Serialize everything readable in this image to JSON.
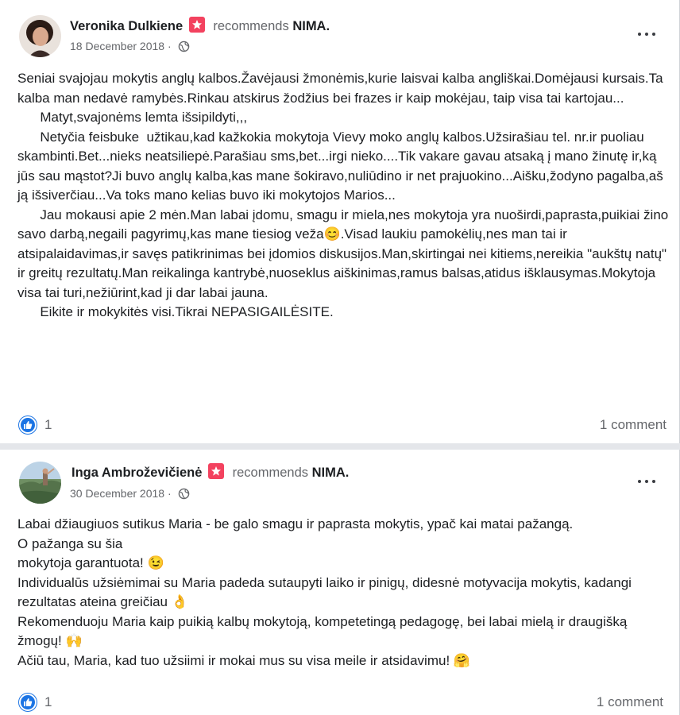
{
  "posts": [
    {
      "author": "Veronika Dulkiene",
      "action": "recommends",
      "page": "NIMA.",
      "date": "18 December 2018 ·",
      "body": [
        "Seniai svajojau mokytis anglų kalbos.Žavėjausi žmonėmis,kurie laisvai kalba angliškai.Domėjausi kursais.Ta kalba man nedavė ramybės.Rinkau atskirus žodžius bei frazes ir kaip mokėjau, taip visa tai kartojau...",
        "      Matyt,svajonėms lemta išsipildyti,,,",
        "      Netyčia feisbuke  užtikau,kad kažkokia mokytoja Vievy moko anglų kalbos.Užsirašiau tel. nr.ir puoliau skambinti.Bet...nieks neatsiliepė.Parašiau sms,bet...irgi nieko....Tik vakare gavau atsaką į mano žinutę ir,ką jūs sau mąstot?Ji buvo anglų kalba,kas mane šokiravo,nuliūdino ir net prajuokino...Aišku,žodyno pagalba,aš ją išsiverčiau...Va toks mano kelias buvo iki mokytojos Marios...",
        "      Jau mokausi apie 2 mėn.Man labai įdomu, smagu ir miela,nes mokytoja yra nuoširdi,paprasta,puikiai žino savo darbą,negaili pagyrimų,kas mane tiesiog veža😊.Visad laukiu pamokėlių,nes man tai ir atsipalaidavimas,ir savęs patikrinimas bei įdomios diskusijos.Man,skirtingai nei kitiems,nereikia \"aukštų natų\" ir greitų rezultatų.Man reikalinga kantrybė,nuoseklus aiškinimas,ramus balsas,atidus išklausymas.Mokytoja visa tai turi,nežiūrint,kad ji dar labai jauna.",
        "      Eikite ir mokykitės visi.Tikrai NEPASIGAILĖSITE."
      ],
      "likes": "1",
      "comments": "1 comment"
    },
    {
      "author": "Inga Ambroževičienė",
      "action": "recommends",
      "page": "NIMA.",
      "date": "30 December 2018 ·",
      "body": [
        "Labai džiaugiuos sutikus Maria - be galo smagu ir paprasta mokytis, ypač kai matai pažangą.",
        "O pažanga su šia",
        "mokytoja garantuota! 😉",
        "Individualūs užsiėmimai su Maria padeda sutaupyti laiko ir pinigų, didesnė motyvacija mokytis, kadangi rezultatas ateina greičiau 👌",
        "Rekomenduoju Maria kaip puikią kalbų mokytoją, kompetetingą pedagogę, bei labai mielą ir draugišką žmogų! 🙌",
        "Ačiū tau, Maria, kad tuo užsiimi ir mokai mus su visa meile ir atsidavimu! 🤗"
      ],
      "likes": "1",
      "comments": "1 comment"
    }
  ],
  "icons": {
    "recommend": "recommend-star-icon",
    "privacy": "globe-icon",
    "more": "more-options-icon",
    "like": "like-thumb-icon"
  },
  "colors": {
    "like_blue": "#1b74e4",
    "recommend_red": "#f3425f",
    "secondary_text": "#65676b"
  }
}
